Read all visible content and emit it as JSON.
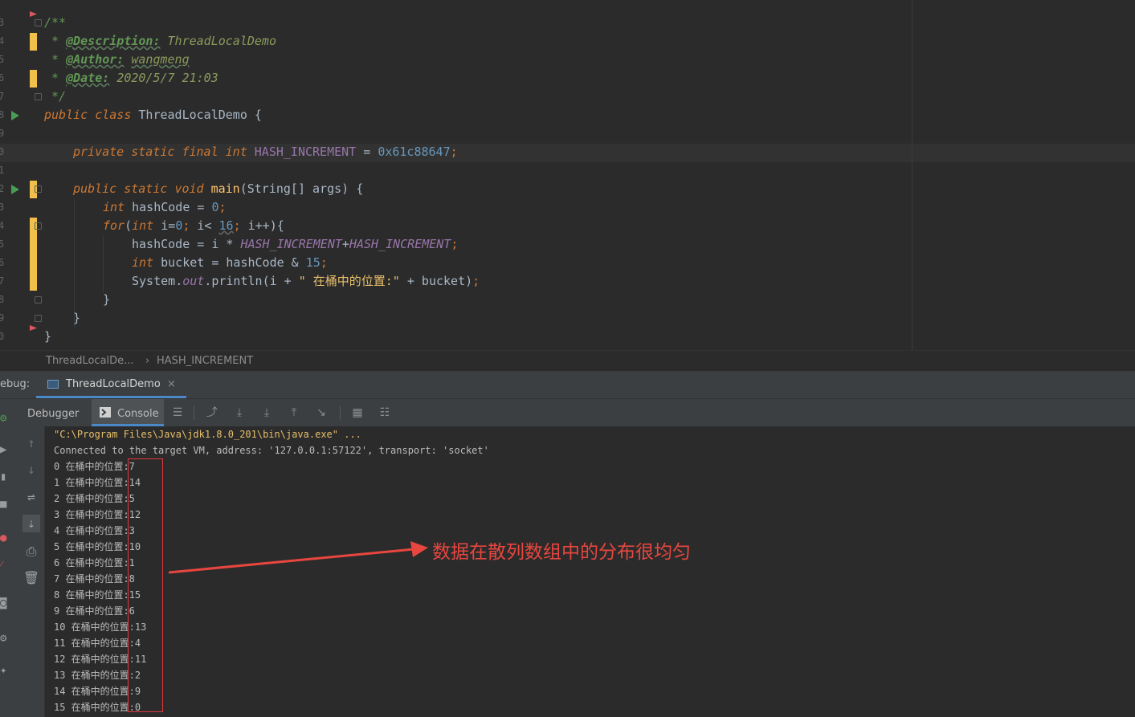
{
  "editor": {
    "line_numbers": [
      "3",
      "4",
      "5",
      "6",
      "7",
      "8",
      "9",
      "0",
      "1",
      "2",
      "3",
      "4",
      "5",
      "6",
      "7",
      "8",
      "9",
      "0"
    ],
    "comment": {
      "open": "/**",
      "desc_tag": "@Description:",
      "desc_value": "ThreadLocalDemo",
      "author_tag": "@Author:",
      "author_value": "wangmeng",
      "date_tag": "@Date:",
      "date_value": "2020/5/7 21:03",
      "close": "*/"
    },
    "class_decl": {
      "kw1": "public",
      "kw2": "class",
      "name": "ThreadLocalDemo",
      "brace": "{"
    },
    "field_decl": {
      "kw1": "private",
      "kw2": "static",
      "kw3": "final",
      "type": "int",
      "name": "HASH_INCREMENT",
      "eq": "=",
      "value": "0x61c88647",
      "semi": ";"
    },
    "main_decl": {
      "kw1": "public",
      "kw2": "static",
      "kw3": "void",
      "name": "main",
      "params": "(String[] args)",
      "brace": "{"
    },
    "line_hash": {
      "type": "int",
      "name": "hashCode",
      "eq": "=",
      "value": "0",
      "semi": ";"
    },
    "line_for": {
      "kw": "for",
      "open": "(",
      "type": "int",
      "init": " i=",
      "zero": "0",
      "sep1": ";",
      "cond": " i< ",
      "limit": "16",
      "sep2": ";",
      "rest": " i++){"
    },
    "line_assign": {
      "lhs": "hashCode",
      "eq": " = ",
      "i": "i",
      "op": " * ",
      "f1": "HASH_INCREMENT",
      "plus": "+",
      "f2": "HASH_INCREMENT",
      "semi": ";"
    },
    "line_bucket": {
      "type": "int",
      "name": "bucket",
      "eq": " = ",
      "rhs": "hashCode",
      "amp": " & ",
      "val": "15",
      "semi": ";"
    },
    "line_print": {
      "cls": "System",
      "dot1": ".",
      "out": "out",
      "dot2": ".",
      "mth": "println",
      "open": "(i + ",
      "str": "\" 在桶中的位置:\"",
      "rest": " + bucket)",
      "semi": ";"
    },
    "close1": "}",
    "close2": "}",
    "close3": "}"
  },
  "breadcrumb": {
    "item1": "ThreadLocalDe...",
    "sep": "›",
    "item2": "HASH_INCREMENT"
  },
  "debug": {
    "label": "ebug:",
    "tab_label": "ThreadLocalDemo",
    "tab_close": "×",
    "debugger_tab": "Debugger",
    "console_tab": "Console"
  },
  "console": {
    "cmd": "\"C:\\Program Files\\Java\\jdk1.8.0_201\\bin\\java.exe\" ...",
    "connected": "Connected to the target VM, address: '127.0.0.1:57122', transport: 'socket'",
    "lines": [
      "0 在桶中的位置:7",
      "1 在桶中的位置:14",
      "2 在桶中的位置:5",
      "3 在桶中的位置:12",
      "4 在桶中的位置:3",
      "5 在桶中的位置:10",
      "6 在桶中的位置:1",
      "7 在桶中的位置:8",
      "8 在桶中的位置:15",
      "9 在桶中的位置:6",
      "10 在桶中的位置:13",
      "11 在桶中的位置:4",
      "12 在桶中的位置:11",
      "13 在桶中的位置:2",
      "14 在桶中的位置:9",
      "15 在桶中的位置:0"
    ]
  },
  "annotation": "数据在散列数组中的分布很均匀",
  "colors": {
    "accent": "#4a88c7",
    "annotation": "#e8463f",
    "modified": "#f0c04a",
    "run": "#499c54"
  }
}
